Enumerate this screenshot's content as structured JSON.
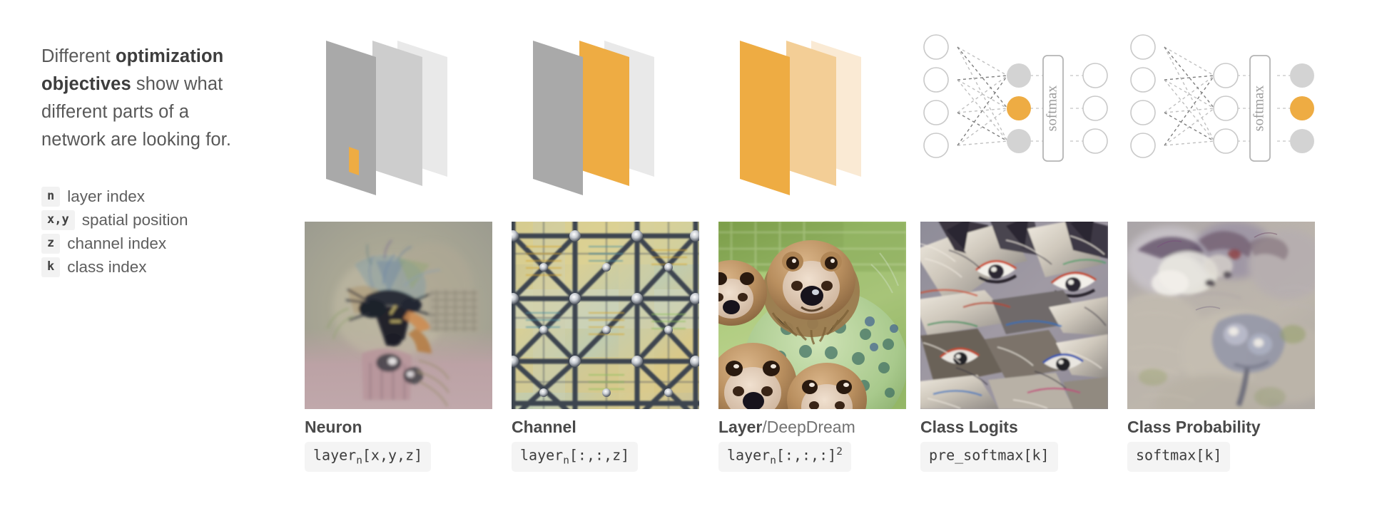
{
  "intro": {
    "pre": "Different ",
    "bold": "optimization objectives",
    "post": " show what different parts of a network are looking for."
  },
  "glossary": [
    {
      "symbol": "n",
      "label": "layer index"
    },
    {
      "symbol": "x,y",
      "label": "spatial position"
    },
    {
      "symbol": "z",
      "label": "channel index"
    },
    {
      "symbol": "k",
      "label": "class index"
    }
  ],
  "colors": {
    "orange": "#eeac43",
    "orange_mid": "#f3ce96",
    "orange_light": "#faead4",
    "gray_front": "#a9a9a9",
    "gray_mid": "#cccccc",
    "gray_back": "#e9e9e9",
    "node_gray": "#d3d3d3",
    "node_stroke": "#c9c9c9",
    "text": "#5c5c5c",
    "chip_bg": "#f4f4f4"
  },
  "columns": [
    {
      "id": "neuron",
      "caption_bold": "Neuron",
      "caption_rest": "",
      "formula": {
        "base": "layer",
        "sub": "n",
        "tail": "[x,y,z]",
        "sup": ""
      },
      "diagram": "planes-neuron",
      "image_alt": "neuron-feature-visualization"
    },
    {
      "id": "channel",
      "caption_bold": "Channel",
      "caption_rest": "",
      "formula": {
        "base": "layer",
        "sub": "n",
        "tail": "[:,:,z]",
        "sup": ""
      },
      "diagram": "planes-channel",
      "image_alt": "channel-feature-visualization"
    },
    {
      "id": "layer",
      "caption_bold": "Layer",
      "caption_rest": "/DeepDream",
      "formula": {
        "base": "layer",
        "sub": "n",
        "tail": "[:,:,:]",
        "sup": "2"
      },
      "diagram": "planes-layer",
      "image_alt": "layer-deepdream-visualization"
    },
    {
      "id": "class-logits",
      "caption_bold": "Class Logits",
      "caption_rest": "",
      "formula": {
        "base": "pre_softmax[k]",
        "sub": "",
        "tail": "",
        "sup": ""
      },
      "diagram": "net-logits",
      "image_alt": "class-logits-visualization"
    },
    {
      "id": "class-probability",
      "caption_bold": "Class Probability",
      "caption_rest": "",
      "formula": {
        "base": "softmax[k]",
        "sub": "",
        "tail": "",
        "sup": ""
      },
      "diagram": "net-probability",
      "image_alt": "class-probability-visualization"
    }
  ],
  "network": {
    "softmax_label": "softmax",
    "input_nodes": 4,
    "hidden_nodes": 3,
    "output_nodes": 3
  }
}
